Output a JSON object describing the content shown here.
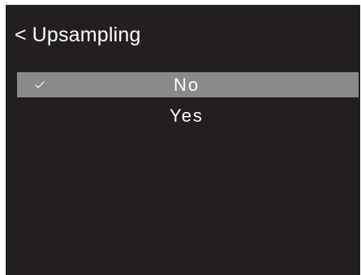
{
  "header": {
    "back_symbol": "<",
    "title": "Upsampling"
  },
  "menu": {
    "items": [
      {
        "label": "No",
        "selected": true,
        "check_icon": "checkmark-icon"
      },
      {
        "label": "Yes",
        "selected": false
      }
    ]
  },
  "colors": {
    "background": "#231f20",
    "selected_row": "#8a8a8a",
    "text": "#ffffff"
  }
}
